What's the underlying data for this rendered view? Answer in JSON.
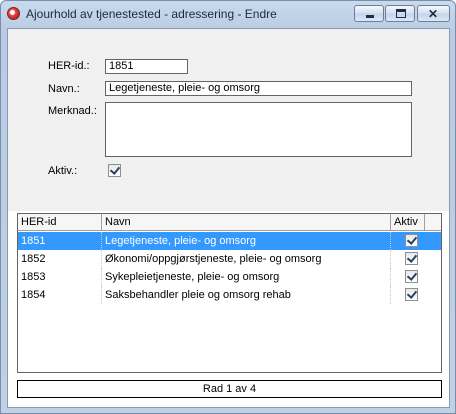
{
  "window": {
    "title": "Ajourhold av tjenestested - adressering - Endre",
    "controls": {
      "minimize_icon": "minimize-icon",
      "maximize_icon": "maximize-icon",
      "close_icon": "close-icon",
      "close_glyph": "✕"
    }
  },
  "form": {
    "her_id_label": "HER-id.:",
    "her_id_value": "1851",
    "navn_label": "Navn.:",
    "navn_value": "Legetjeneste, pleie- og omsorg",
    "merknad_label": "Merknad.:",
    "merknad_value": "",
    "aktiv_label": "Aktiv.:",
    "aktiv_checked": true
  },
  "grid": {
    "columns": [
      "HER-id",
      "Navn",
      "Aktiv"
    ],
    "rows": [
      {
        "her_id": "1851",
        "navn": "Legetjeneste, pleie- og omsorg",
        "aktiv": true,
        "selected": true
      },
      {
        "her_id": "1852",
        "navn": "Økonomi/oppgjørstjeneste, pleie- og omsorg",
        "aktiv": true,
        "selected": false
      },
      {
        "her_id": "1853",
        "navn": "Sykepleietjeneste, pleie- og omsorg",
        "aktiv": true,
        "selected": false
      },
      {
        "her_id": "1854",
        "navn": "Saksbehandler pleie og omsorg rehab",
        "aktiv": true,
        "selected": false
      }
    ]
  },
  "status": {
    "text": "Rad 1 av 4"
  }
}
